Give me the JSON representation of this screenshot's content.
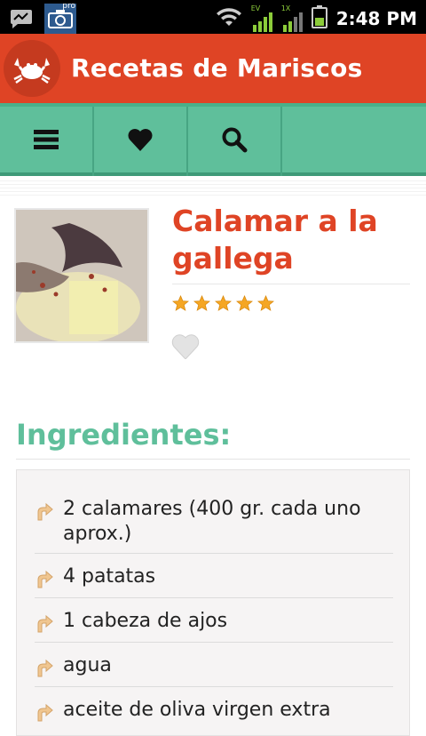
{
  "status_bar": {
    "time": "2:48 PM",
    "pro_badge": "pro",
    "signal_labels": [
      "EV",
      "1X"
    ],
    "icons": [
      "messaging-icon",
      "camera-pro-icon",
      "wifi-icon",
      "signal-ev-icon",
      "signal-1x-icon",
      "battery-icon"
    ]
  },
  "app_bar": {
    "title": "Recetas de Mariscos",
    "logo_icon": "crab-icon"
  },
  "toolbar": {
    "buttons": [
      {
        "icon": "menu-icon"
      },
      {
        "icon": "heart-icon"
      },
      {
        "icon": "search-icon"
      }
    ]
  },
  "recipe": {
    "title": "Calamar a la gallega",
    "rating": 5,
    "rating_max": 5,
    "favorite": false
  },
  "ingredients": {
    "heading": "Ingredientes:",
    "items": [
      "2 calamares (400 gr. cada uno aprox.)",
      "4 patatas",
      "1 cabeza de ajos",
      "agua",
      "aceite de oliva virgen extra"
    ]
  },
  "colors": {
    "accent_red": "#df4425",
    "accent_green": "#5fbf9b",
    "star": "#f5a623"
  }
}
